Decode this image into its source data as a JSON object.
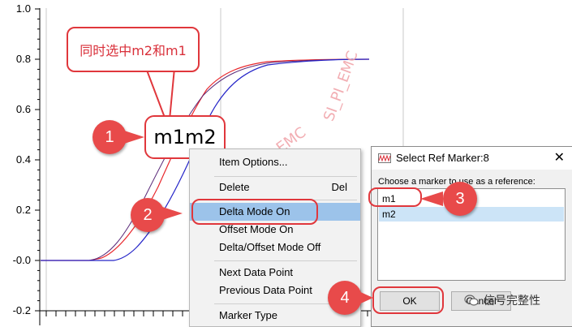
{
  "plot": {
    "y_ticks": [
      "1.0",
      "0.8",
      "0.6",
      "0.4",
      "0.2",
      "-0.0",
      "-0.2"
    ],
    "colors": {
      "curve_red": "#e8262b",
      "curve_blue": "#2424c8",
      "curve_purple": "#5a2a7a",
      "grid": "#c8c8c8",
      "marker": "#1ecbd8"
    }
  },
  "callout": {
    "text": "同时选中m2和m1"
  },
  "marker_label": {
    "text": "m1m2"
  },
  "steps": [
    "1",
    "2",
    "3",
    "4"
  ],
  "context_menu": {
    "items": [
      {
        "label": "Item Options...",
        "shortcut": ""
      },
      {
        "label": "Delete",
        "shortcut": "Del"
      },
      {
        "label": "Delta Mode On",
        "shortcut": ""
      },
      {
        "label": "Offset Mode On",
        "shortcut": ""
      },
      {
        "label": "Delta/Offset Mode Off",
        "shortcut": ""
      },
      {
        "label": "Next Data Point",
        "shortcut": ""
      },
      {
        "label": "Previous Data Point",
        "shortcut": ""
      },
      {
        "label": "Marker Type",
        "shortcut": ""
      }
    ]
  },
  "dialog": {
    "title": "Select Ref Marker:8",
    "close": "✕",
    "prompt": "Choose a marker to use as a reference:",
    "markers": [
      "m1",
      "m2"
    ],
    "ok_label": "OK",
    "cancel_label": "Cancel"
  },
  "watermarks": {
    "vertical": "SI_PI_EMC",
    "diagonal": "公众号：SI_PI_EMC"
  },
  "wechat": {
    "text": "信号完整性"
  }
}
